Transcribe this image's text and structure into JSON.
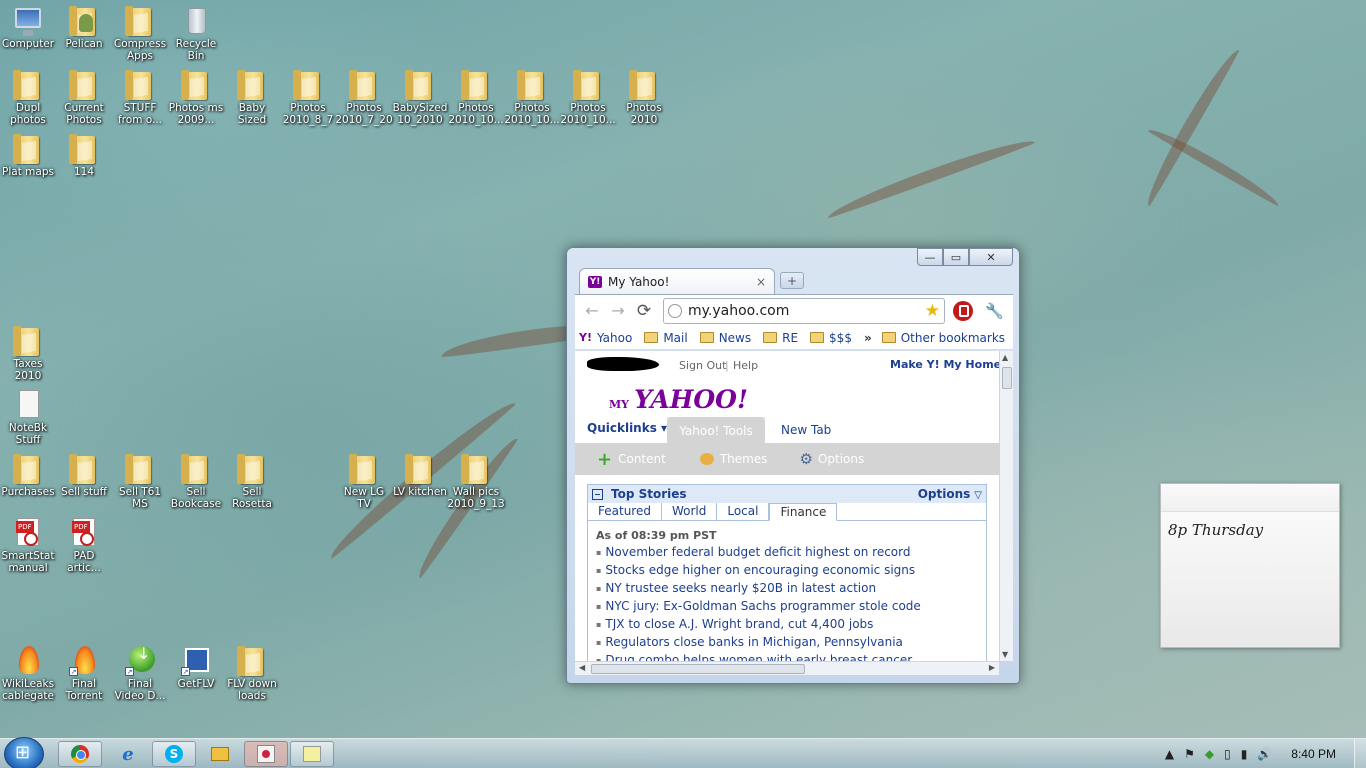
{
  "desktop": {
    "icons": [
      {
        "label": "Computer",
        "type": "computer"
      },
      {
        "label": "Pelican",
        "type": "user"
      },
      {
        "label": "Compress Apps",
        "type": "folder"
      },
      {
        "label": "Recycle Bin",
        "type": "bin"
      },
      {
        "label": "Dupl photos",
        "type": "folder"
      },
      {
        "label": "Current Photos",
        "type": "folder"
      },
      {
        "label": "STUFF from o...",
        "type": "folder"
      },
      {
        "label": "Photos ms 2009...",
        "type": "folder"
      },
      {
        "label": "Baby Sized",
        "type": "folder"
      },
      {
        "label": "Photos 2010_8_7",
        "type": "folder"
      },
      {
        "label": "Photos 2010_7_20",
        "type": "folder"
      },
      {
        "label": "BabySized 10_2010",
        "type": "folder"
      },
      {
        "label": "Photos 2010_10...",
        "type": "folder"
      },
      {
        "label": "Photos 2010_10...",
        "type": "folder"
      },
      {
        "label": "Photos 2010_10...",
        "type": "folder"
      },
      {
        "label": "Photos 2010",
        "type": "folder"
      },
      {
        "label": "Plat maps",
        "type": "folder"
      },
      {
        "label": "114",
        "type": "folder"
      },
      {
        "label": "Taxes 2010",
        "type": "folder"
      },
      {
        "label": "NoteBk Stuff",
        "type": "notebook"
      },
      {
        "label": "Purchases",
        "type": "folder"
      },
      {
        "label": "Sell stuff",
        "type": "folder"
      },
      {
        "label": "Sell T61 MS",
        "type": "folder"
      },
      {
        "label": "Sell Bookcase",
        "type": "folder"
      },
      {
        "label": "Sell Rosetta",
        "type": "folder"
      },
      {
        "label": "New LG TV",
        "type": "folder"
      },
      {
        "label": "LV kitchen",
        "type": "folder"
      },
      {
        "label": "Wall pics 2010_9_13",
        "type": "folder"
      },
      {
        "label": "SmartStat manual",
        "type": "pdf"
      },
      {
        "label": "PAD artic...",
        "type": "pdf"
      },
      {
        "label": "WikiLeaks cablegate",
        "type": "flame"
      },
      {
        "label": "Final Torrent",
        "type": "flame"
      },
      {
        "label": "Final Video D...",
        "type": "arrow"
      },
      {
        "label": "GetFLV",
        "type": "getflv"
      },
      {
        "label": "FLV down loads",
        "type": "folder"
      }
    ]
  },
  "browser": {
    "tab_title": "My Yahoo!",
    "favicon_text": "Y!",
    "tab_close": "×",
    "newtab_glyph": "+",
    "url": "my.yahoo.com",
    "controls": {
      "minimize": "—",
      "maximize": "▭",
      "close": "✕"
    },
    "nav": {
      "back": "←",
      "forward": "→",
      "reload": "⟳",
      "star": "★",
      "wrench": "🔧"
    },
    "bookmarks": [
      {
        "label": "Yahoo",
        "icon": "Y!"
      },
      {
        "label": "Mail"
      },
      {
        "label": "News"
      },
      {
        "label": "RE"
      },
      {
        "label": "$$$"
      }
    ],
    "bookmarks_overflow": "»",
    "other_bookmarks": "Other bookmarks"
  },
  "yahoo": {
    "sign_out": "Sign Out",
    "separator": "|",
    "help": "Help",
    "make_homepage": "Make Y! My Homepa",
    "logo_my": "MY",
    "logo_yahoo": "YAHOO!",
    "quicklinks": "Quicklinks ▾",
    "tab_tools": "Yahoo! Tools",
    "tab_new": "New Tab",
    "tools": {
      "content": "Content",
      "themes": "Themes",
      "options": "Options",
      "plus": "+",
      "gear": "⚙"
    },
    "module": {
      "title": "Top Stories",
      "options": "Options",
      "options_caret": "▽",
      "tabs": [
        "Featured",
        "World",
        "Local",
        "Finance"
      ],
      "active_tab": "Finance",
      "as_of": "As of 08:39 pm PST",
      "stories": [
        "November federal budget deficit highest on record",
        "Stocks edge higher on encouraging economic signs",
        "NY trustee seeks nearly $20B in latest action",
        "NYC jury: Ex-Goldman Sachs programmer stole code",
        "TJX to close A.J. Wright brand, cut 4,400 jobs",
        "Regulators close banks in Michigan, Pennsylvania",
        "Drug combo helps women with early breast cancer"
      ]
    }
  },
  "sticky_note": {
    "text": "8p Thursday"
  },
  "taskbar": {
    "apps": [
      "chrome",
      "internet-explorer",
      "skype",
      "windows-explorer",
      "paint",
      "sticky-notes"
    ],
    "clock": "8:40 PM",
    "tray": {
      "show_hidden": "▲",
      "flag": "⚑",
      "network": "▮",
      "volume": "🔊"
    }
  },
  "colors": {
    "yahoo_purple": "#7b0099",
    "link_blue": "#1d3f8f"
  }
}
